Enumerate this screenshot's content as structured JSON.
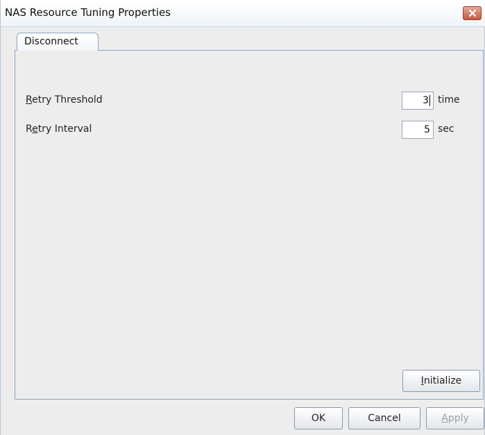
{
  "window": {
    "title": "NAS Resource Tuning Properties"
  },
  "tabs": [
    {
      "label": "Disconnect"
    }
  ],
  "fields": [
    {
      "mnemonic": "R",
      "label_rest": "etry Threshold",
      "value": "3",
      "unit": "time"
    },
    {
      "label_pre": "R",
      "mnemonic": "e",
      "label_rest": "try Interval",
      "value": "5",
      "unit": "sec"
    }
  ],
  "buttons": {
    "initialize_mnemonic": "I",
    "initialize_rest": "nitialize",
    "ok": "OK",
    "cancel": "Cancel",
    "apply_mnemonic": "A",
    "apply_rest": "pply"
  },
  "colors": {
    "close_button": "#c55a43",
    "tab_border": "#8ea3bd"
  }
}
